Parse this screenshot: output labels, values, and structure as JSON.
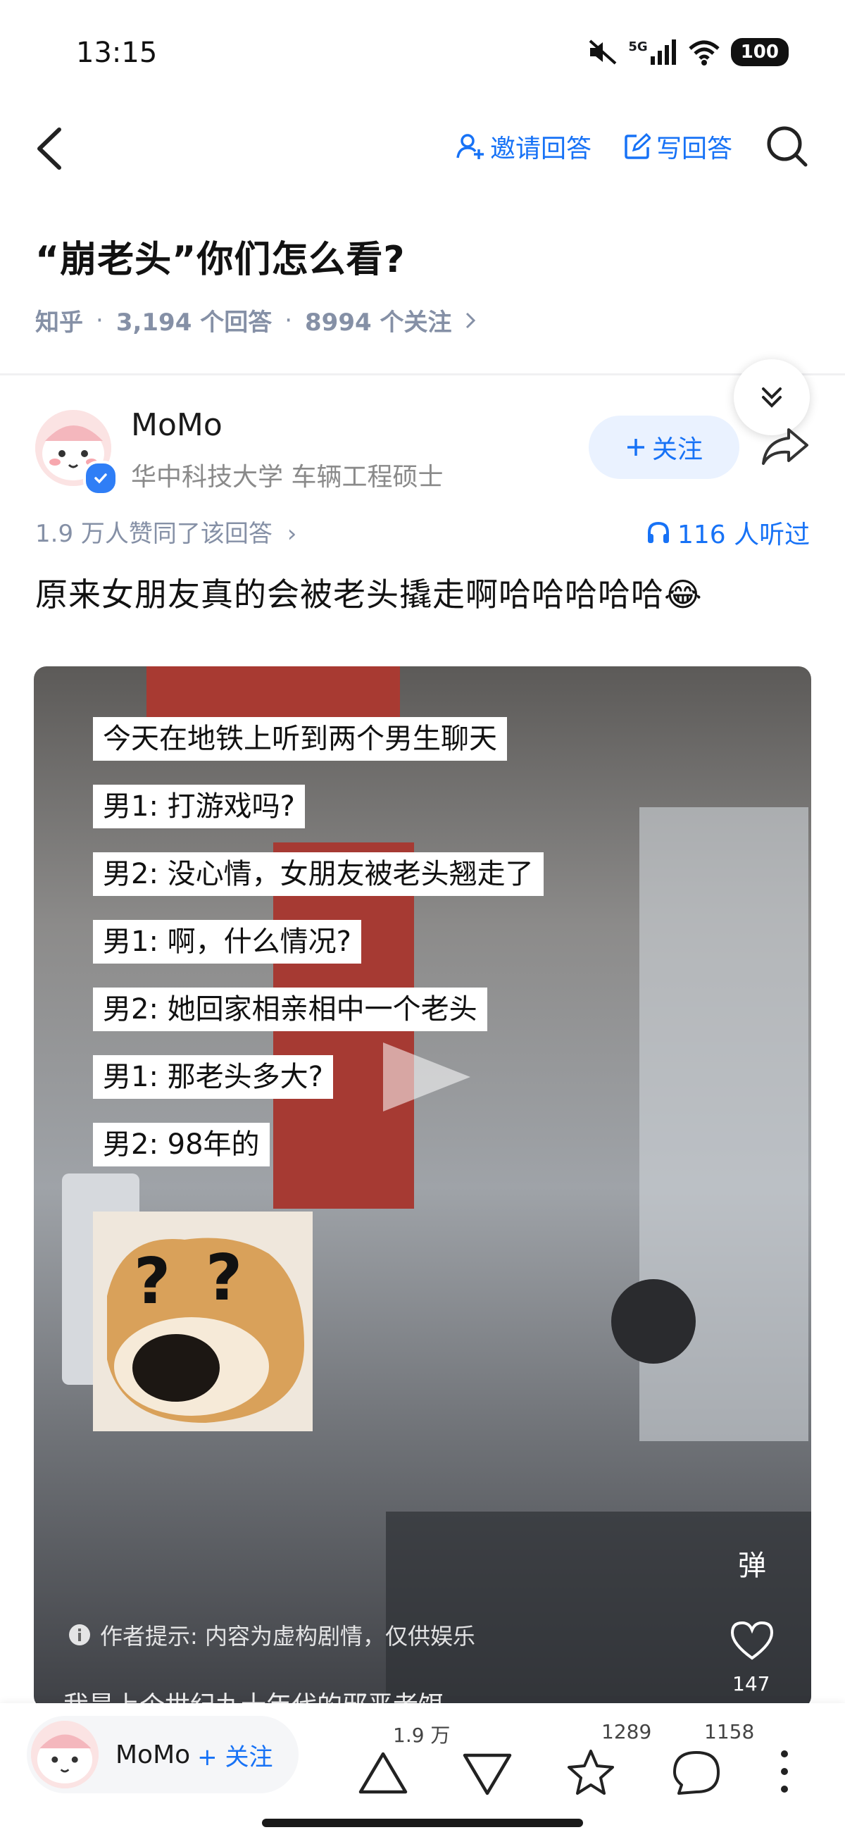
{
  "status_bar": {
    "time": "13:15",
    "network": "5G",
    "battery": "100"
  },
  "nav": {
    "invite_label": "邀请回答",
    "write_label": "写回答"
  },
  "question": {
    "title": "“崩老头”你们怎么看?",
    "source": "知乎",
    "answers": "3,194 个回答",
    "followers": "8994 个关注",
    "separator": "·"
  },
  "author": {
    "name": "MoMo",
    "bio": "华中科技大学 车辆工程硕士",
    "follow_label": "关注"
  },
  "answer": {
    "likes_text": "1.9 万人赞同了该回答",
    "listen_text": "116 人听过",
    "text": "原来女朋友真的会被老头撬走啊哈哈哈哈哈😂"
  },
  "video": {
    "captions": [
      "今天在地铁上听到两个男生聊天",
      "男1: 打游戏吗?",
      "男2: 没心情，女朋友被老头翘走了",
      "男1: 啊，什么情况?",
      "男2: 她回家相亲相中一个老头",
      "男1: 那老头多大?",
      "男2: 98年的"
    ],
    "danmaku_label": "弹",
    "like_count": "147",
    "author_tip": "作者提示: 内容为虚构剧情，仅供娱乐",
    "bottom_text": "我是上个世纪九十年代的邪恶老饵"
  },
  "bottom_bar": {
    "author_name": "MoMo",
    "follow_label": "+ 关注",
    "upvote_count": "1.9 万",
    "favorite_count": "1289",
    "comment_count": "1158"
  },
  "colors": {
    "accent": "#1772f6",
    "meta_gray": "#8590a6"
  }
}
